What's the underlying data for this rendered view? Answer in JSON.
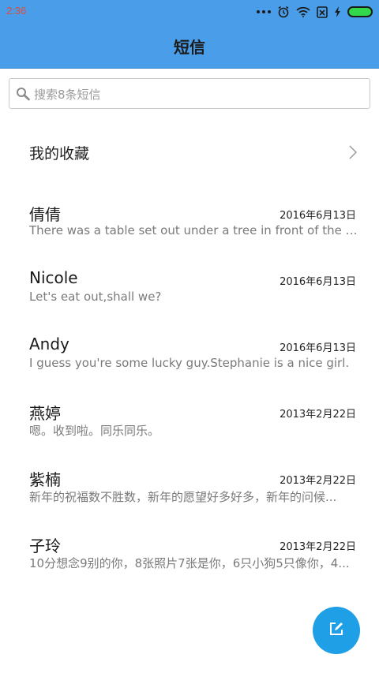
{
  "status": {
    "time": "2:36",
    "icons": [
      "more-dots-icon",
      "alarm-icon",
      "wifi-icon",
      "no-sim-icon",
      "charging-icon",
      "battery-icon"
    ]
  },
  "header": {
    "title": "短信"
  },
  "search": {
    "placeholder": "搜索8条短信"
  },
  "favorites": {
    "label": "我的收藏"
  },
  "conversations": [
    {
      "name": "倩倩",
      "date": "2016年6月13日",
      "preview": "There was a table set out under a tree in front of the ho..."
    },
    {
      "name": "Nicole",
      "date": "2016年6月13日",
      "preview": "Let's eat out,shall we?"
    },
    {
      "name": "Andy",
      "date": "2016年6月13日",
      "preview": "I guess you're some lucky guy.Stephanie is a nice girl."
    },
    {
      "name": "燕婷",
      "date": "2013年2月22日",
      "preview": "嗯。收到啦。同乐同乐。"
    },
    {
      "name": "紫楠",
      "date": "2013年2月22日",
      "preview": "新年的祝福数不胜数，新年的愿望好多好多，新年的问候..."
    },
    {
      "name": "子玲",
      "date": "2013年2月22日",
      "preview": "10分想念9别的你，8张照片7张是你，6只小狗5只像你，4..."
    }
  ],
  "fab": {
    "icon": "compose-icon"
  },
  "colors": {
    "header_bg": "#4a9ee9",
    "fab_bg": "#1fa0e6",
    "time_color": "#e04b3a",
    "battery": "#32d74b"
  }
}
